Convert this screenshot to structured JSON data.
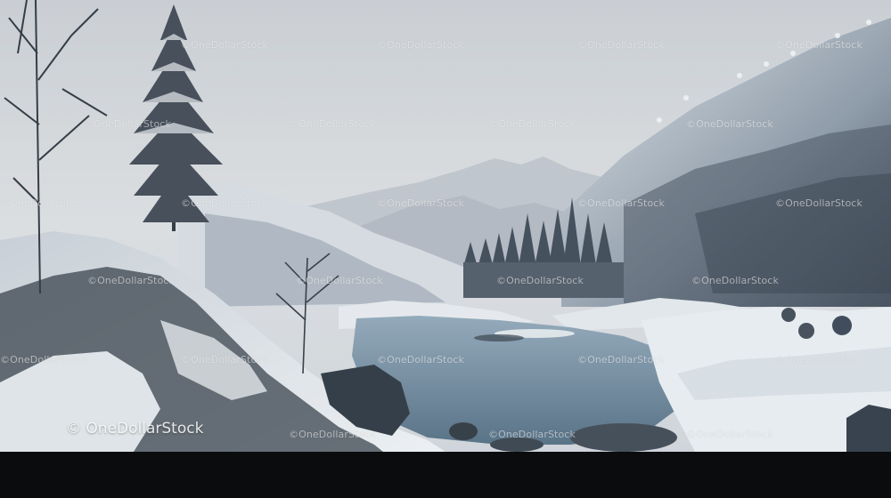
{
  "image": {
    "subject": "snowy mountain valley with river",
    "palette": {
      "sky": "#d9dbde",
      "far_mountains": "#b7bdc5",
      "snow": "#e9edf1",
      "rock_dark": "#2a3440",
      "forest": "#3b4652",
      "water": "#6f8da3",
      "bottom_bar": "#0b0c0e"
    }
  },
  "watermark": {
    "text": "©OneDollarStock",
    "main_text": "© OneDollarStock"
  }
}
